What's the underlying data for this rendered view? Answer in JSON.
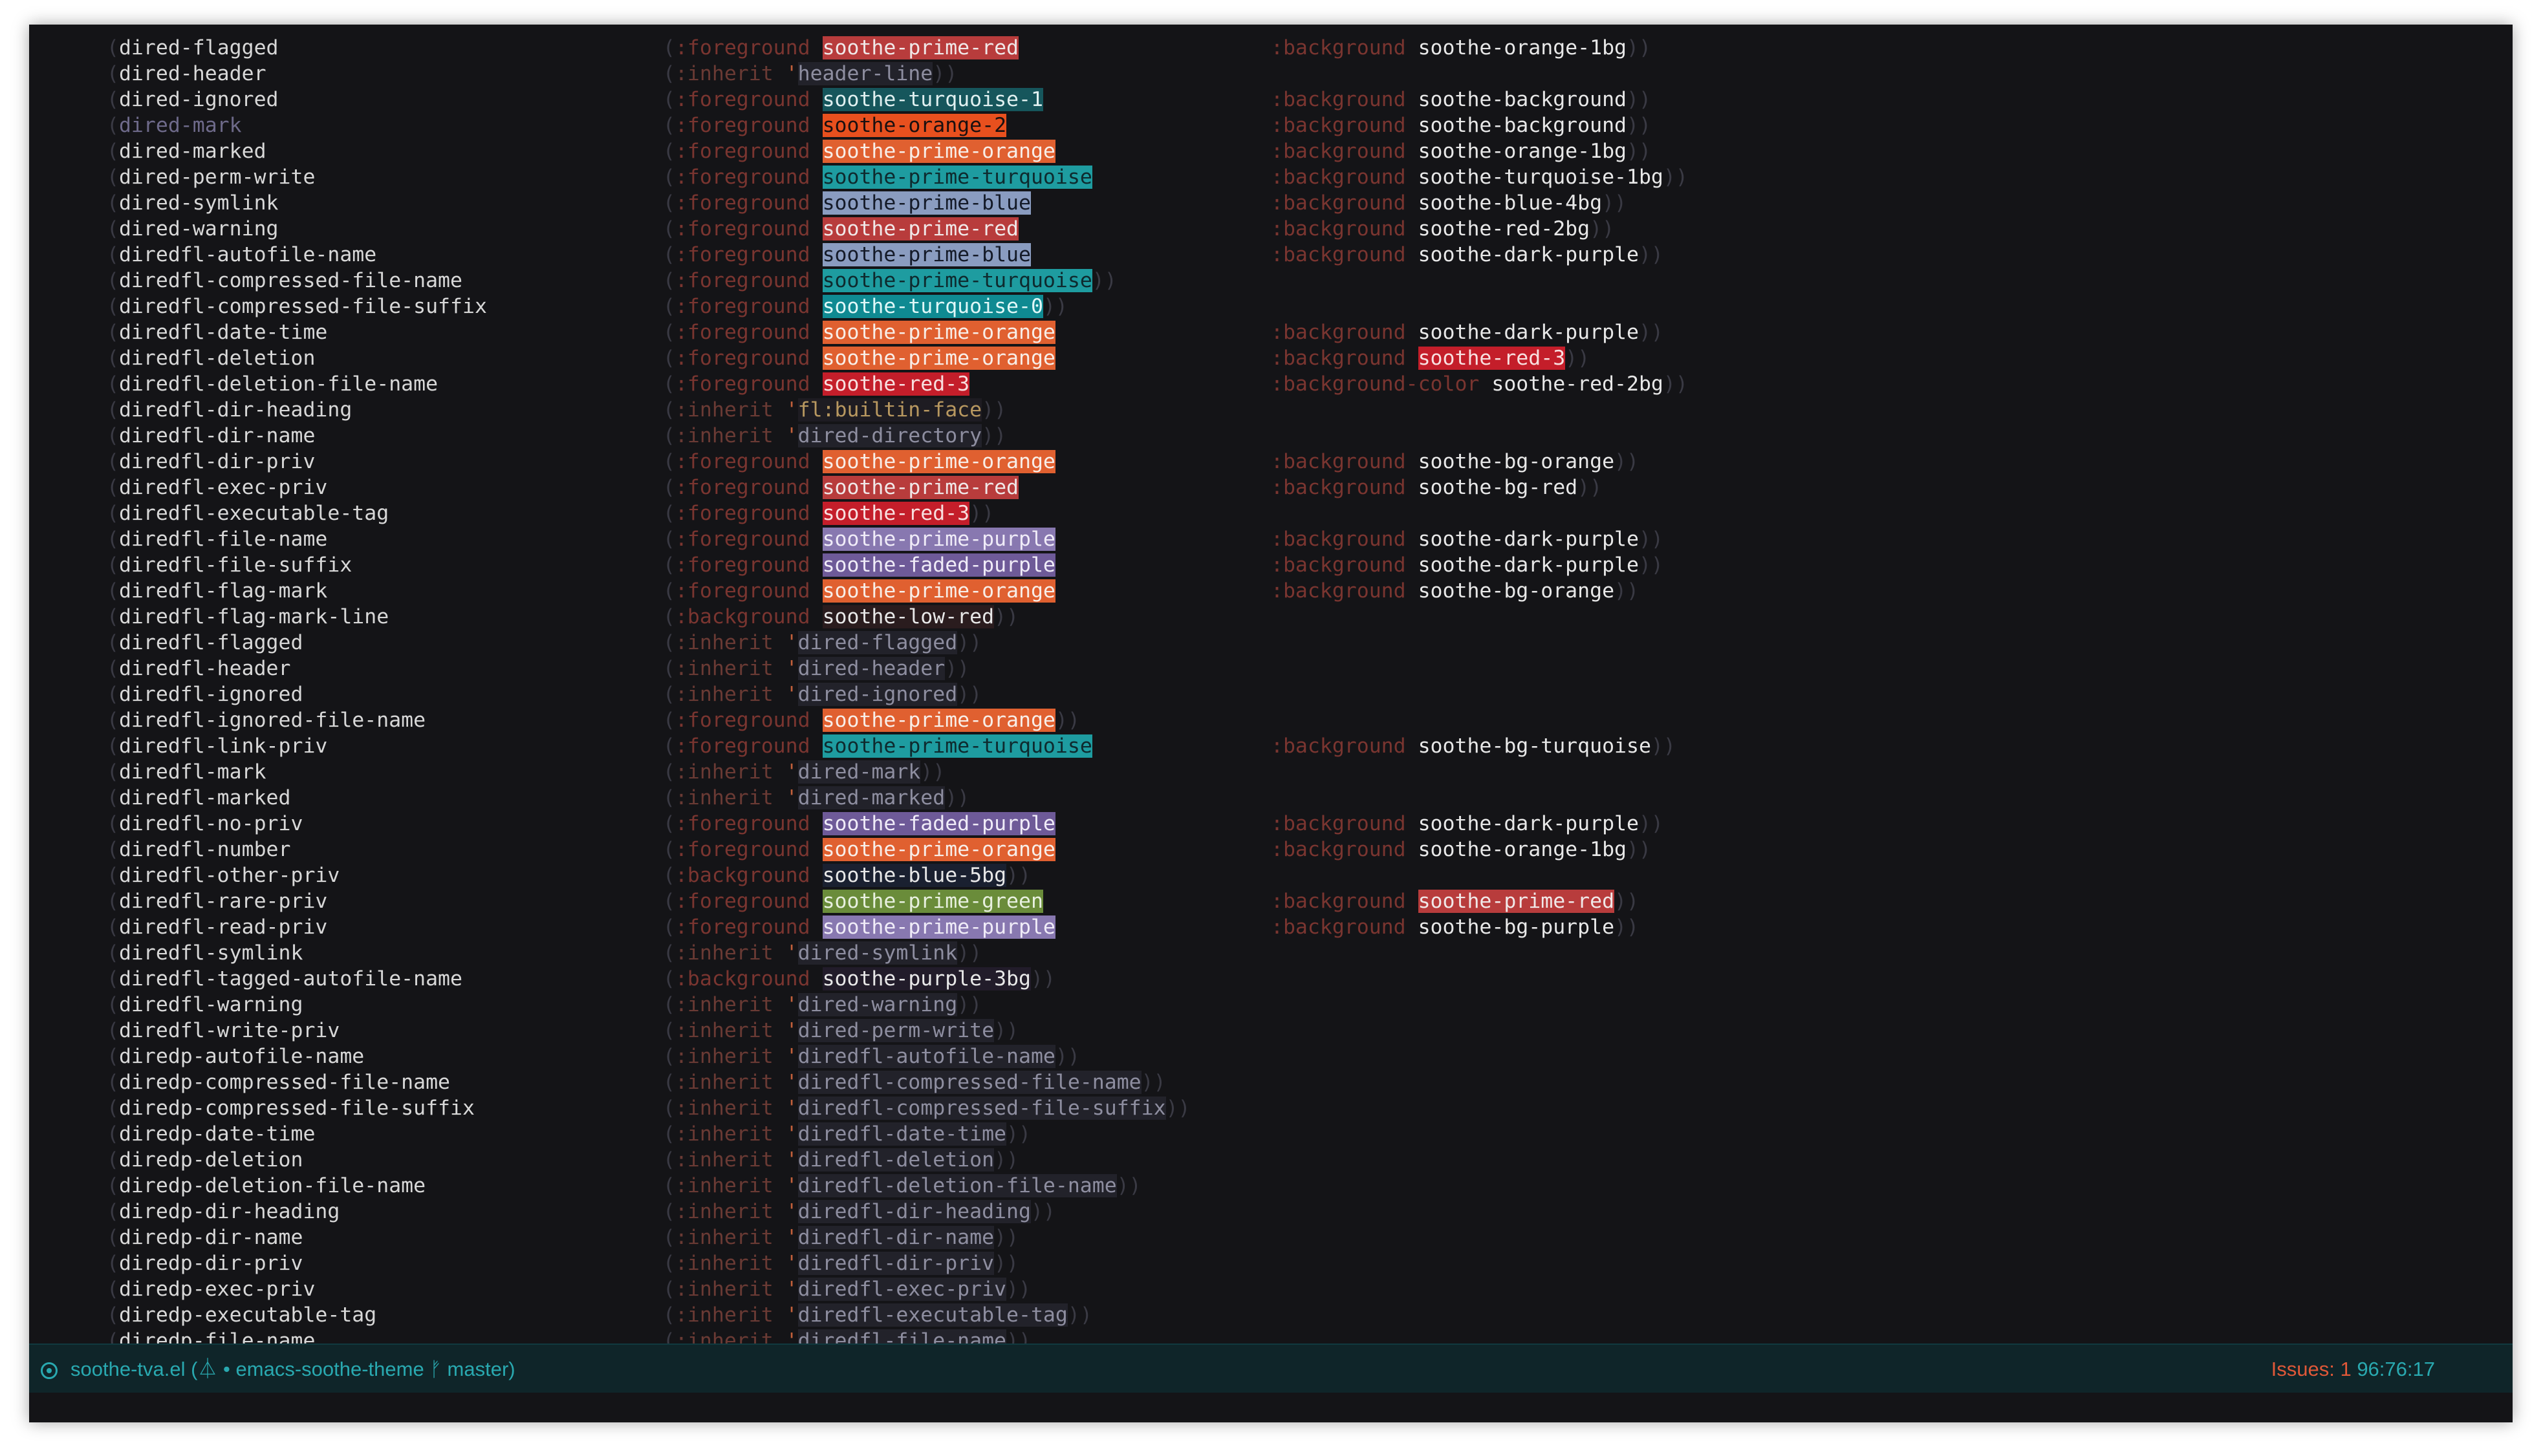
{
  "colors": {
    "bg": "#141417",
    "modeline_bg": "#0f2529",
    "accent": "#29a9b0",
    "issues": "#e05838"
  },
  "faces": [
    {
      "name": "dired-flagged",
      "prop": ":foreground",
      "value": "soothe-prime-red",
      "vbg": "#b83c3c",
      "vfg": "#f0e8e8",
      "bgprop": ":background",
      "bgvalue": "soothe-orange-1bg"
    },
    {
      "name": "dired-header",
      "prop": ":inherit",
      "quote": true,
      "value": "header-line",
      "vfg": "#8e8ea0",
      "vbg": "#22222a"
    },
    {
      "name": "dired-ignored",
      "prop": ":foreground",
      "value": "soothe-turquoise-1",
      "vbg": "#16565c",
      "vfg": "#e0f0f0",
      "bgprop": ":background",
      "bgvalue": "soothe-background"
    },
    {
      "name": "dired-mark",
      "dim": true,
      "prop": ":foreground",
      "value": "soothe-orange-2",
      "vbg": "#e8501e",
      "vfg": "#1a1010",
      "bgprop": ":background",
      "bgvalue": "soothe-background"
    },
    {
      "name": "dired-marked",
      "prop": ":foreground",
      "value": "soothe-prime-orange",
      "vbg": "#e06030",
      "vfg": "#f8eee8",
      "bgprop": ":background",
      "bgvalue": "soothe-orange-1bg"
    },
    {
      "name": "dired-perm-write",
      "prop": ":foreground",
      "value": "soothe-prime-turquoise",
      "vbg": "#1e9ca0",
      "vfg": "#0e2a2e",
      "bgprop": ":background",
      "bgvalue": "soothe-turquoise-1bg"
    },
    {
      "name": "dired-symlink",
      "prop": ":foreground",
      "value": "soothe-prime-blue",
      "vbg": "#8a9cc0",
      "vfg": "#141a28",
      "bgprop": ":background",
      "bgvalue": "soothe-blue-4bg"
    },
    {
      "name": "dired-warning",
      "prop": ":foreground",
      "value": "soothe-prime-red",
      "vbg": "#b83c3c",
      "vfg": "#f0e8e8",
      "bgprop": ":background",
      "bgvalue": "soothe-red-2bg"
    },
    {
      "name": "diredfl-autofile-name",
      "prop": ":foreground",
      "value": "soothe-prime-blue",
      "vbg": "#8a9cc0",
      "vfg": "#141a28",
      "bgprop": ":background",
      "bgvalue": "soothe-dark-purple"
    },
    {
      "name": "diredfl-compressed-file-name",
      "prop": ":foreground",
      "value": "soothe-prime-turquoise",
      "vbg": "#1e9ca0",
      "vfg": "#0e2a2e"
    },
    {
      "name": "diredfl-compressed-file-suffix",
      "prop": ":foreground",
      "value": "soothe-turquoise-0",
      "vbg": "#0f8a92",
      "vfg": "#e0f8f8"
    },
    {
      "name": "diredfl-date-time",
      "prop": ":foreground",
      "value": "soothe-prime-orange",
      "vbg": "#e06030",
      "vfg": "#f8eee8",
      "bgprop": ":background",
      "bgvalue": "soothe-dark-purple"
    },
    {
      "name": "diredfl-deletion",
      "prop": ":foreground",
      "value": "soothe-prime-orange",
      "vbg": "#e06030",
      "vfg": "#f8eee8",
      "bgprop": ":background",
      "bgvalue": "soothe-red-3",
      "bgvbg": "#c41e2a",
      "bgvfg": "#f8e0e0"
    },
    {
      "name": "diredfl-deletion-file-name",
      "prop": ":foreground",
      "value": "soothe-red-3",
      "vbg": "#c41e2a",
      "vfg": "#f8e0e0",
      "bgprop": ":background-color",
      "bgvalue": "soothe-red-2bg"
    },
    {
      "name": "diredfl-dir-heading",
      "prop": ":inherit",
      "quote": true,
      "value": "fl:builtin-face",
      "vfg": "#b89860",
      "vbg": "#1e1c22"
    },
    {
      "name": "diredfl-dir-name",
      "prop": ":inherit",
      "quote": true,
      "value": "dired-directory",
      "vfg": "#8e8ea0",
      "vbg": "#22222a"
    },
    {
      "name": "diredfl-dir-priv",
      "prop": ":foreground",
      "value": "soothe-prime-orange",
      "vbg": "#e06030",
      "vfg": "#f8eee8",
      "bgprop": ":background",
      "bgvalue": "soothe-bg-orange"
    },
    {
      "name": "diredfl-exec-priv",
      "prop": ":foreground",
      "value": "soothe-prime-red",
      "vbg": "#b83c3c",
      "vfg": "#f0e8e8",
      "bgprop": ":background",
      "bgvalue": "soothe-bg-red"
    },
    {
      "name": "diredfl-executable-tag",
      "prop": ":foreground",
      "value": "soothe-red-3",
      "vbg": "#c41e2a",
      "vfg": "#f8e0e0"
    },
    {
      "name": "diredfl-file-name",
      "prop": ":foreground",
      "value": "soothe-prime-purple",
      "vbg": "#8878b0",
      "vfg": "#f0ecf8",
      "bgprop": ":background",
      "bgvalue": "soothe-dark-purple"
    },
    {
      "name": "diredfl-file-suffix",
      "prop": ":foreground",
      "value": "soothe-faded-purple",
      "vbg": "#6e5a98",
      "vfg": "#f0ecf8",
      "bgprop": ":background",
      "bgvalue": "soothe-dark-purple"
    },
    {
      "name": "diredfl-flag-mark",
      "prop": ":foreground",
      "value": "soothe-prime-orange",
      "vbg": "#e06030",
      "vfg": "#f8eee8",
      "bgprop": ":background",
      "bgvalue": "soothe-bg-orange"
    },
    {
      "name": "diredfl-flag-mark-line",
      "prop": ":background",
      "value": "soothe-low-red",
      "vfg": "#e8e8e8",
      "vbg": "#2a1c1e"
    },
    {
      "name": "diredfl-flagged",
      "prop": ":inherit",
      "quote": true,
      "value": "dired-flagged",
      "vfg": "#8e8ea0",
      "vbg": "#22222a"
    },
    {
      "name": "diredfl-header",
      "prop": ":inherit",
      "quote": true,
      "value": "dired-header",
      "vfg": "#8e8ea0",
      "vbg": "#22222a"
    },
    {
      "name": "diredfl-ignored",
      "prop": ":inherit",
      "quote": true,
      "value": "dired-ignored",
      "vfg": "#8e8ea0",
      "vbg": "#22222a"
    },
    {
      "name": "diredfl-ignored-file-name",
      "prop": ":foreground",
      "value": "soothe-prime-orange",
      "vbg": "#e06030",
      "vfg": "#f8eee8"
    },
    {
      "name": "diredfl-link-priv",
      "prop": ":foreground",
      "value": "soothe-prime-turquoise",
      "vbg": "#1e9ca0",
      "vfg": "#0e2a2e",
      "bgprop": ":background",
      "bgvalue": "soothe-bg-turquoise"
    },
    {
      "name": "diredfl-mark",
      "prop": ":inherit",
      "quote": true,
      "value": "dired-mark",
      "vfg": "#8e8ea0",
      "vbg": "#22222a"
    },
    {
      "name": "diredfl-marked",
      "prop": ":inherit",
      "quote": true,
      "value": "dired-marked",
      "vfg": "#8e8ea0",
      "vbg": "#22222a"
    },
    {
      "name": "diredfl-no-priv",
      "prop": ":foreground",
      "value": "soothe-faded-purple",
      "vbg": "#6e5a98",
      "vfg": "#f0ecf8",
      "bgprop": ":background",
      "bgvalue": "soothe-dark-purple"
    },
    {
      "name": "diredfl-number",
      "prop": ":foreground",
      "value": "soothe-prime-orange",
      "vbg": "#e06030",
      "vfg": "#f8eee8",
      "bgprop": ":background",
      "bgvalue": "soothe-orange-1bg"
    },
    {
      "name": "diredfl-other-priv",
      "prop": ":background",
      "value": "soothe-blue-5bg",
      "vfg": "#e8e8e8",
      "vbg": "#1a2030"
    },
    {
      "name": "diredfl-rare-priv",
      "prop": ":foreground",
      "value": "soothe-prime-green",
      "vbg": "#6a8c3a",
      "vfg": "#e8f0e0",
      "bgprop": ":background",
      "bgvalue": "soothe-prime-red",
      "bgvbg": "#b83c3c",
      "bgvfg": "#f0e8e8"
    },
    {
      "name": "diredfl-read-priv",
      "prop": ":foreground",
      "value": "soothe-prime-purple",
      "vbg": "#8878b0",
      "vfg": "#f0ecf8",
      "bgprop": ":background",
      "bgvalue": "soothe-bg-purple"
    },
    {
      "name": "diredfl-symlink",
      "prop": ":inherit",
      "quote": true,
      "value": "dired-symlink",
      "vfg": "#8e8ea0",
      "vbg": "#22222a"
    },
    {
      "name": "diredfl-tagged-autofile-name",
      "prop": ":background",
      "value": "soothe-purple-3bg",
      "vfg": "#e8e8e8",
      "vbg": "#221c2a"
    },
    {
      "name": "diredfl-warning",
      "prop": ":inherit",
      "quote": true,
      "value": "dired-warning",
      "vfg": "#8e8ea0",
      "vbg": "#22222a"
    },
    {
      "name": "diredfl-write-priv",
      "prop": ":inherit",
      "quote": true,
      "value": "dired-perm-write",
      "vfg": "#8e8ea0",
      "vbg": "#22222a"
    },
    {
      "name": "diredp-autofile-name",
      "prop": ":inherit",
      "quote": true,
      "value": "diredfl-autofile-name",
      "vfg": "#8e8ea0",
      "vbg": "#22222a"
    },
    {
      "name": "diredp-compressed-file-name",
      "prop": ":inherit",
      "quote": true,
      "value": "diredfl-compressed-file-name",
      "vfg": "#8e8ea0",
      "vbg": "#22222a"
    },
    {
      "name": "diredp-compressed-file-suffix",
      "prop": ":inherit",
      "quote": true,
      "value": "diredfl-compressed-file-suffix",
      "vfg": "#8e8ea0",
      "vbg": "#22222a"
    },
    {
      "name": "diredp-date-time",
      "prop": ":inherit",
      "quote": true,
      "value": "diredfl-date-time",
      "vfg": "#8e8ea0",
      "vbg": "#22222a"
    },
    {
      "name": "diredp-deletion",
      "prop": ":inherit",
      "quote": true,
      "value": "diredfl-deletion",
      "vfg": "#8e8ea0",
      "vbg": "#22222a"
    },
    {
      "name": "diredp-deletion-file-name",
      "prop": ":inherit",
      "quote": true,
      "value": "diredfl-deletion-file-name",
      "vfg": "#8e8ea0",
      "vbg": "#22222a"
    },
    {
      "name": "diredp-dir-heading",
      "prop": ":inherit",
      "quote": true,
      "value": "diredfl-dir-heading",
      "vfg": "#8e8ea0",
      "vbg": "#22222a"
    },
    {
      "name": "diredp-dir-name",
      "prop": ":inherit",
      "quote": true,
      "value": "diredfl-dir-name",
      "vfg": "#8e8ea0",
      "vbg": "#22222a"
    },
    {
      "name": "diredp-dir-priv",
      "prop": ":inherit",
      "quote": true,
      "value": "diredfl-dir-priv",
      "vfg": "#8e8ea0",
      "vbg": "#22222a"
    },
    {
      "name": "diredp-exec-priv",
      "prop": ":inherit",
      "quote": true,
      "value": "diredfl-exec-priv",
      "vfg": "#8e8ea0",
      "vbg": "#22222a"
    },
    {
      "name": "diredp-executable-tag",
      "prop": ":inherit",
      "quote": true,
      "value": "diredfl-executable-tag",
      "vfg": "#8e8ea0",
      "vbg": "#22222a"
    },
    {
      "name": "diredp-file-name",
      "prop": ":inherit",
      "quote": true,
      "value": "diredfl-file-name",
      "vfg": "#8e8ea0",
      "vbg": "#22222a"
    }
  ],
  "modeline": {
    "icon": "record-icon",
    "filename": "soothe-tva.el",
    "project_open": " (",
    "vc_icon": "git-icon",
    "project": " • emacs-soothe-theme ",
    "branch_icon": "branch-icon",
    "branch": " master)",
    "issues": "Issues: 1",
    "position": " 96:76:17"
  }
}
